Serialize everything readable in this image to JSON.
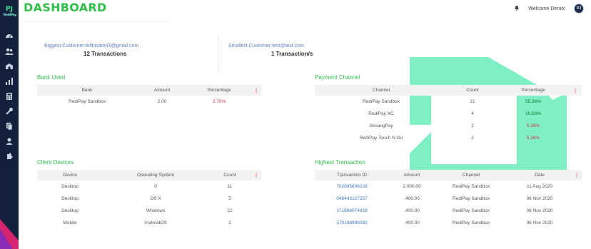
{
  "page": {
    "title": "DASHBOARD"
  },
  "header": {
    "welcome": "Welcome Demo!",
    "avatar_initials": "PJ"
  },
  "sidebar": {
    "logo_text": "PJ",
    "logo_sub": "RediPay",
    "items": [
      {
        "icon": "dashboard-icon"
      },
      {
        "icon": "users-icon"
      },
      {
        "icon": "merchants-icon"
      },
      {
        "icon": "reports-icon"
      },
      {
        "icon": "calculator-icon"
      },
      {
        "icon": "tools-icon"
      },
      {
        "icon": "documents-icon"
      },
      {
        "icon": "user-icon"
      },
      {
        "icon": "settings-icon"
      }
    ]
  },
  "stats": {
    "biggest": {
      "label": "Biggest Customer:",
      "email": "telthisam93@gmail.com",
      "count": "12 Transactions"
    },
    "smallest": {
      "label": "Smallest Customer:",
      "email": "test@test.com",
      "count": "1 Transaction/s"
    }
  },
  "bank_used": {
    "title": "Bank Used",
    "headers": [
      "Bank",
      "Amount",
      "Percentage"
    ],
    "rows": [
      {
        "bank": "RediPay Sandbox",
        "amount": "2.00",
        "percentage": "2.70%"
      }
    ]
  },
  "payment_channel": {
    "title": "Payment Channel",
    "headers": [
      "Channel",
      "Count",
      "Percentage"
    ],
    "rows": [
      {
        "channel": "RediPay Sandbox",
        "count": "21",
        "percentage": "55.26%",
        "tone": "green"
      },
      {
        "channel": "RediPay XC",
        "count": "4",
        "percentage": "10.53%",
        "tone": "green"
      },
      {
        "channel": "SenangPay",
        "count": "2",
        "percentage": "5.26%",
        "tone": "red"
      },
      {
        "channel": "RediPay Touch N Go",
        "count": "2",
        "percentage": "5.26%",
        "tone": "red"
      }
    ]
  },
  "client_devices": {
    "title": "Client Devices",
    "headers": [
      "Device",
      "Operating System",
      "Count"
    ],
    "rows": [
      {
        "device": "Desktop",
        "os": "0",
        "count": "11"
      },
      {
        "device": "Desktop",
        "os": "OS X",
        "count": "5"
      },
      {
        "device": "Desktop",
        "os": "Windows",
        "count": "22"
      },
      {
        "device": "Mobile",
        "os": "AndroidOS",
        "count": "2"
      }
    ]
  },
  "highest_transaction": {
    "title": "Highest Transaction",
    "headers": [
      "Transaction ID",
      "Amount",
      "Channel",
      "Date"
    ],
    "rows": [
      {
        "id": "702095606233",
        "amount": "2,000.00",
        "channel": "RediPay Sandbox",
        "date": "11 Aug 2020"
      },
      {
        "id": "048443127257",
        "amount": ".400.00",
        "channel": "RediPay Sandbox",
        "date": "06 Nov 2020"
      },
      {
        "id": "371998074929",
        "amount": ".400.00",
        "channel": "RediPay Sandbox",
        "date": "06 Nov 2020"
      },
      {
        "id": "570198998263",
        "amount": ".400.00",
        "channel": "RediPay Sandbox",
        "date": "06 Nov 2020"
      }
    ]
  },
  "colors": {
    "accent": "#2fbf4a",
    "sidebar": "#14213d",
    "deco": "#7ef0c4"
  }
}
